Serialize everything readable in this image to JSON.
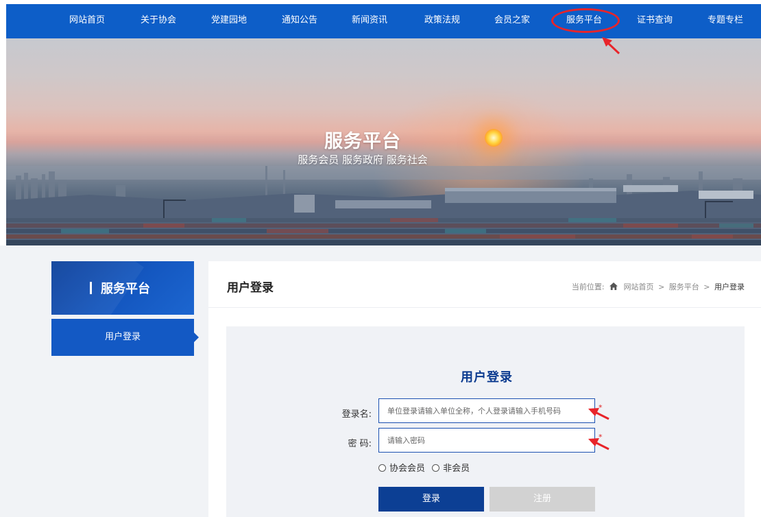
{
  "nav": {
    "items": [
      {
        "label": "网站首页"
      },
      {
        "label": "关于协会"
      },
      {
        "label": "党建园地"
      },
      {
        "label": "通知公告"
      },
      {
        "label": "新闻资讯"
      },
      {
        "label": "政策法规"
      },
      {
        "label": "会员之家"
      },
      {
        "label": "服务平台",
        "highlighted": true
      },
      {
        "label": "证书查询"
      },
      {
        "label": "专题专栏"
      }
    ]
  },
  "hero": {
    "title": "服务平台",
    "subtitle": "服务会员 服务政府 服务社会"
  },
  "sidebar": {
    "title": "服务平台",
    "items": [
      {
        "label": "用户登录",
        "active": true
      }
    ]
  },
  "main": {
    "title": "用户登录",
    "breadcrumb": {
      "prefix": "当前位置:",
      "items": [
        "网站首页",
        "服务平台",
        "用户登录"
      ],
      "separator": ">"
    }
  },
  "login": {
    "title": "用户登录",
    "username": {
      "label": "登录名:",
      "placeholder": "单位登录请输入单位全称，个人登录请输入手机号码",
      "value": "",
      "required_mark": "*"
    },
    "password": {
      "label": "密 码:",
      "placeholder": "请输入密码",
      "value": "",
      "required_mark": "*"
    },
    "member_type": {
      "options": [
        "协会会员",
        "非会员"
      ],
      "selected": null
    },
    "login_button": "登录",
    "register_button": "注册"
  },
  "colors": {
    "nav_bg": "#0d5ec8",
    "accent_dark": "#0c3f94",
    "sidebar_active": "#1359c4",
    "annotation_red": "#e8242a",
    "register_disabled": "#d2d2d2"
  },
  "icons": {
    "breadcrumb_home": "home-icon",
    "annotation": "red-arrow-icon"
  }
}
